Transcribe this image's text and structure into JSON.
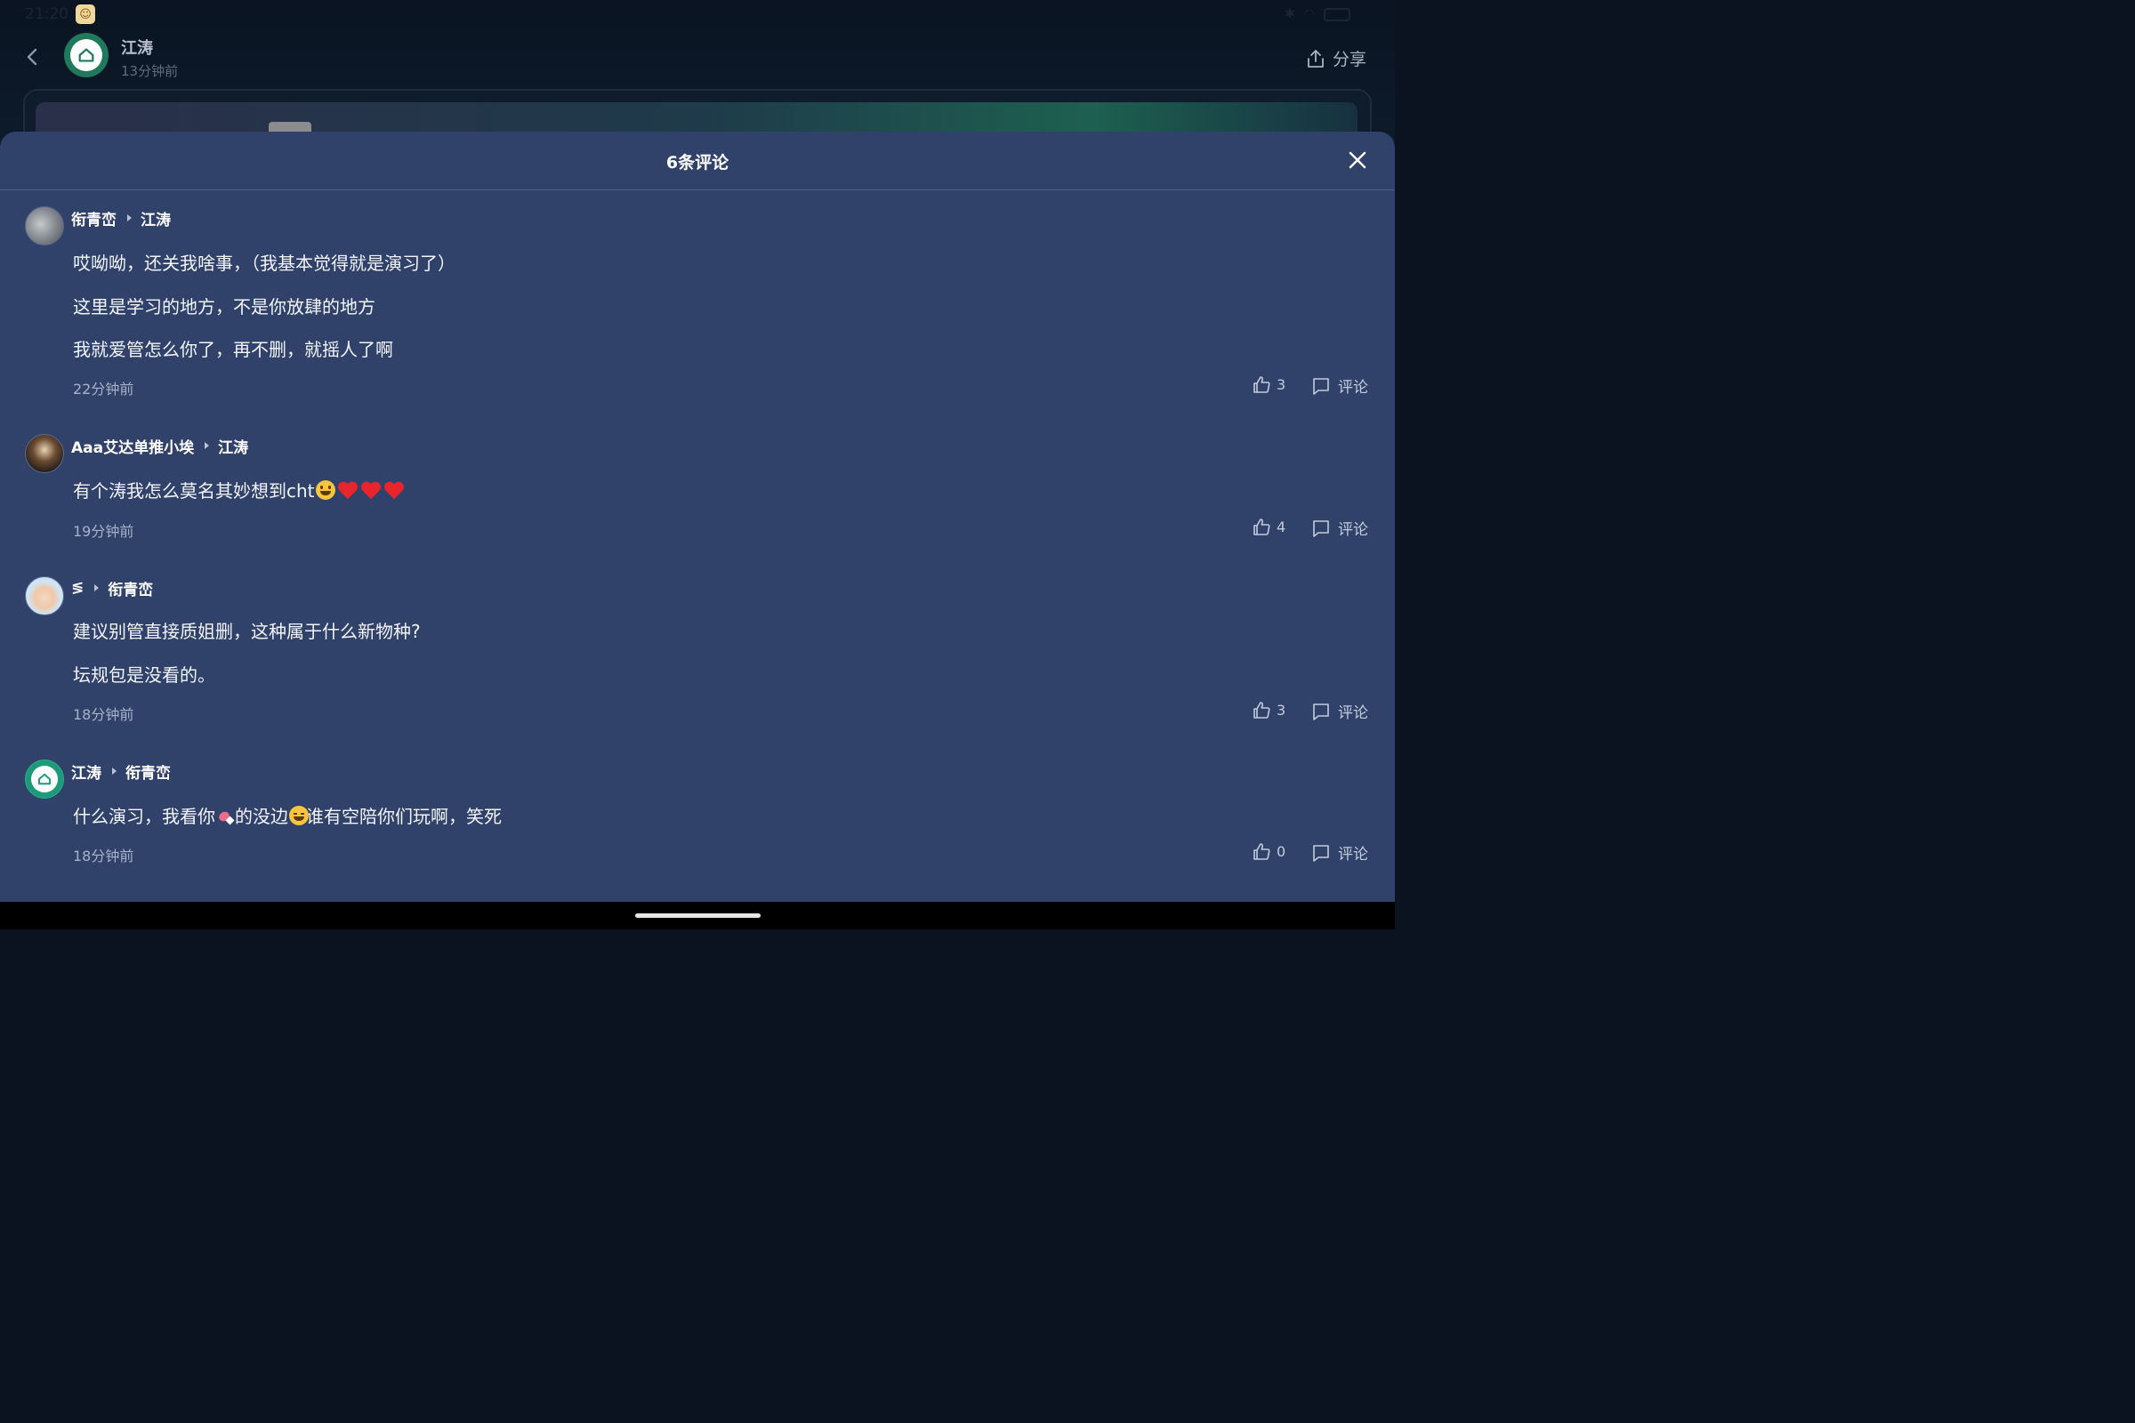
{
  "status": {
    "time": "21:20"
  },
  "post_header": {
    "author": "江涛",
    "time": "13分钟前",
    "share_label": "分享"
  },
  "sheet": {
    "title": "6条评论"
  },
  "comments": [
    {
      "author": "衔青峦",
      "reply_to": "江涛",
      "paragraphs": [
        "哎呦呦，还关我啥事，（我基本觉得就是演习了）",
        "这里是学习的地方，不是你放肆的地方",
        "我就爱管怎么你了，再不删，就摇人了啊"
      ],
      "time": "22分钟前",
      "likes": "3",
      "comment_label": "评论"
    },
    {
      "author": "Aaa艾达单推小埃",
      "reply_to": "江涛",
      "text_before": "有个涛我怎么莫名其妙想到cht",
      "time": "19分钟前",
      "likes": "4",
      "comment_label": "评论"
    },
    {
      "author": "≶",
      "reply_to": "衔青峦",
      "paragraphs": [
        "建议别管直接质姐删，这种属于什么新物种?",
        "坛规包是没看的。"
      ],
      "time": "18分钟前",
      "likes": "3",
      "comment_label": "评论"
    },
    {
      "author": "江涛",
      "reply_to": "衔青峦",
      "text_part1": "什么演习，我看你",
      "text_part2": "的没边",
      "text_part3": "谁有空陪你们玩啊，笑死",
      "time": "18分钟前",
      "likes": "0",
      "comment_label": "评论"
    }
  ],
  "colors": {
    "sheet_bg": "#31426a",
    "page_bg": "#0b1220",
    "brand_green": "#1e9a7a"
  }
}
